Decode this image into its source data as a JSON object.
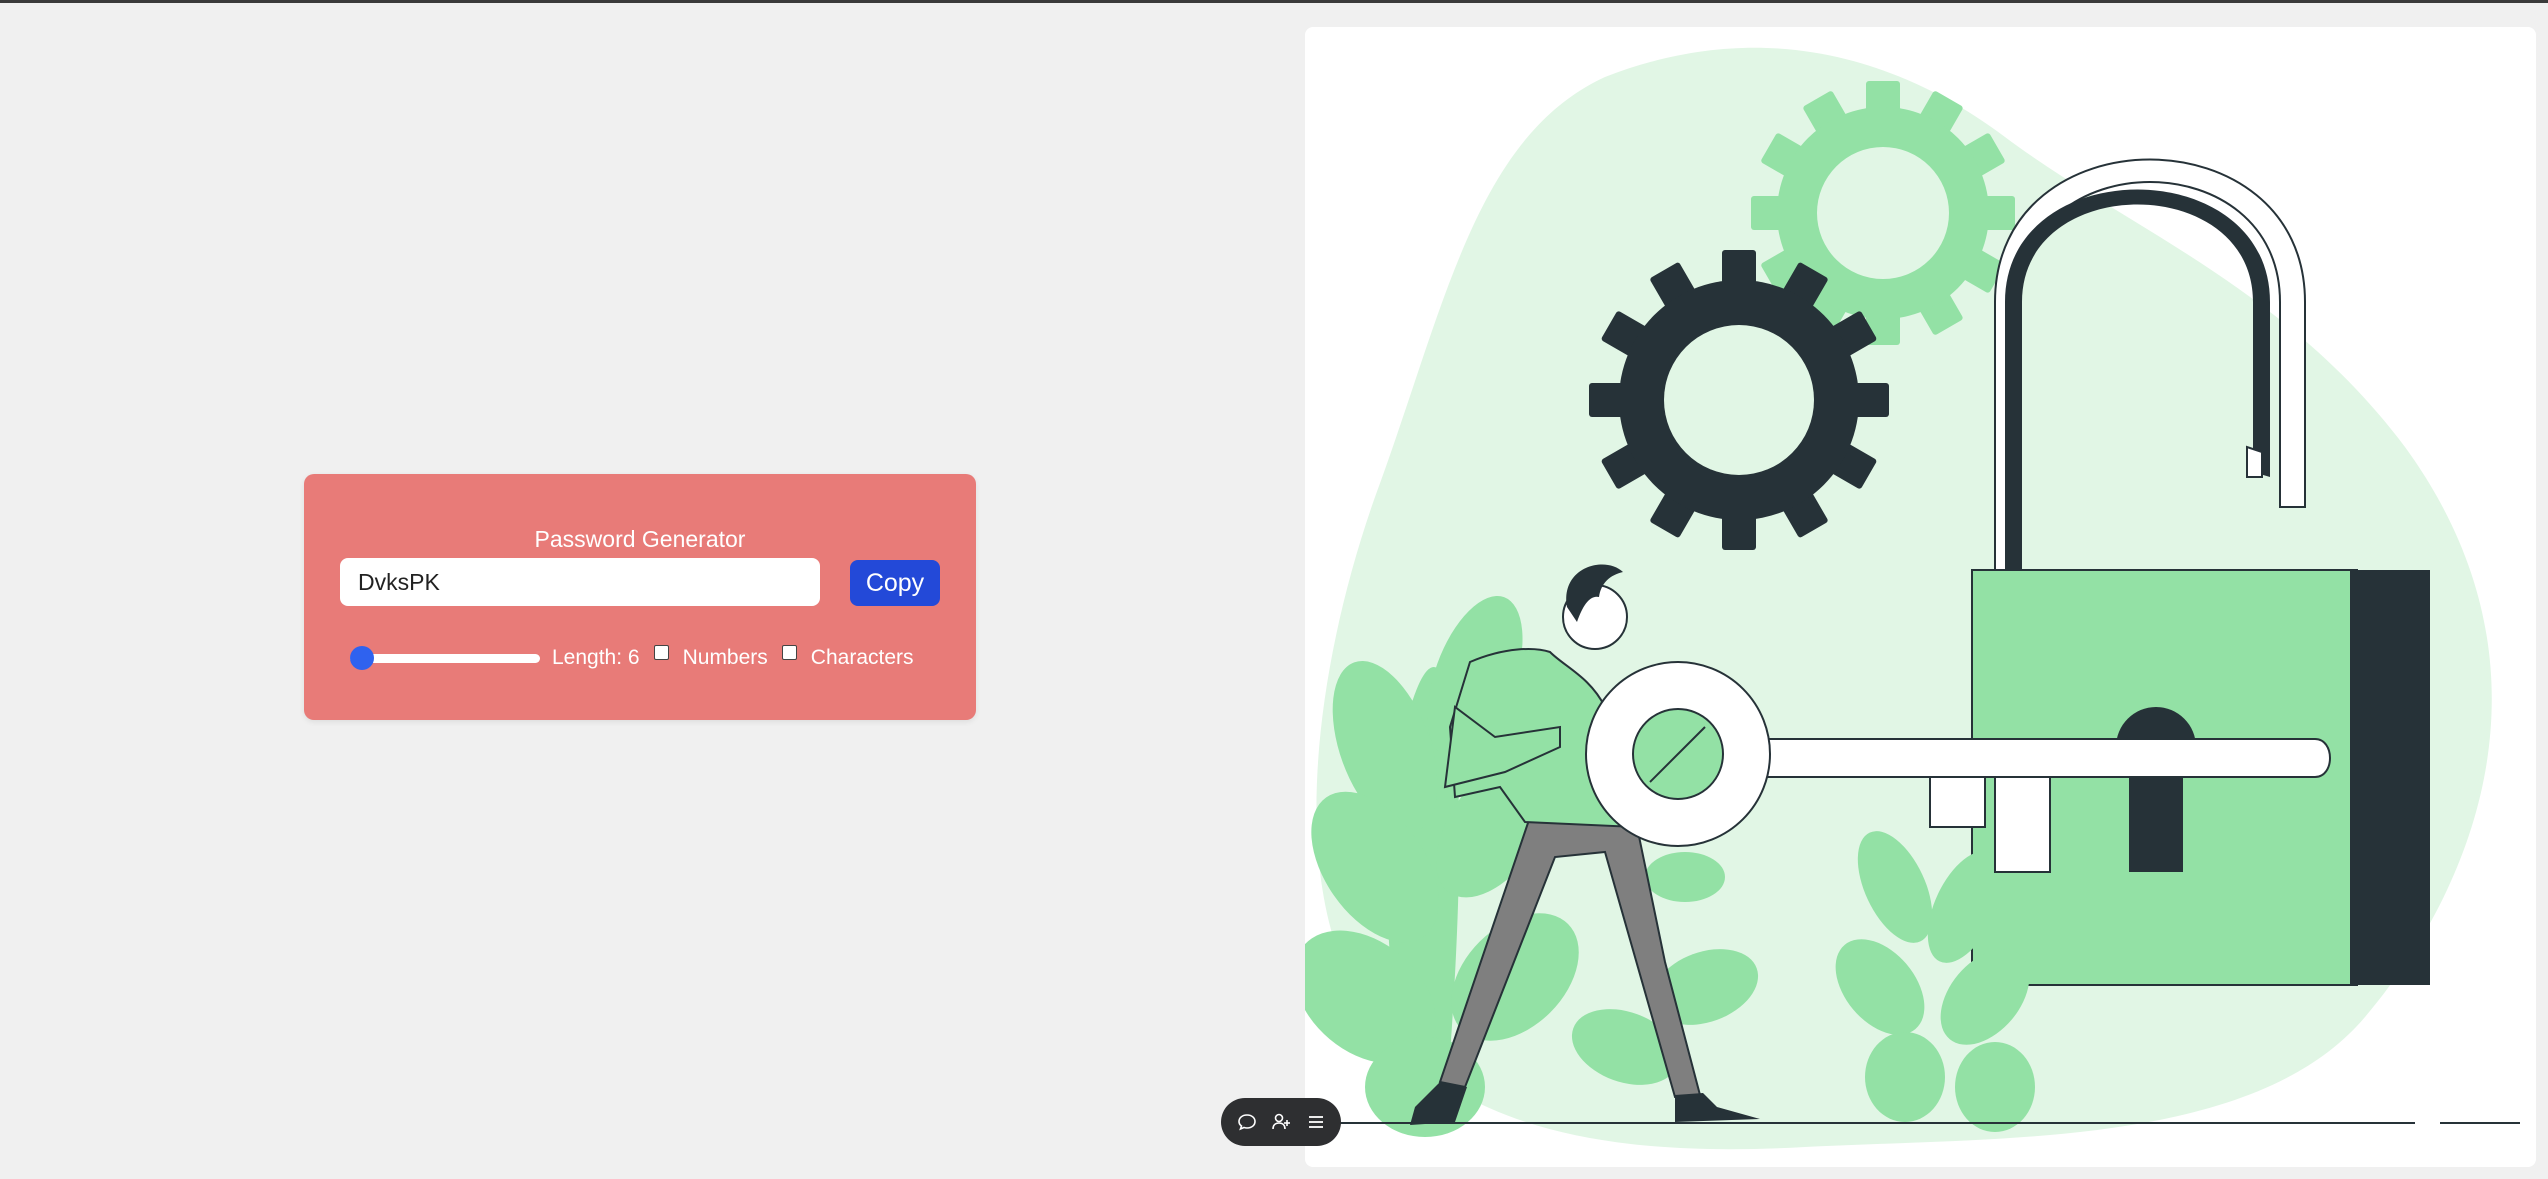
{
  "generator": {
    "title": "Password Generator",
    "password_value": "DvksPK",
    "copy_label": "Copy",
    "length_label": "Length: 6",
    "length_value": 6,
    "numbers_label": "Numbers",
    "numbers_checked": false,
    "characters_label": "Characters",
    "characters_checked": false
  },
  "illustration": {
    "icons": [
      "gear-icon",
      "padlock-icon",
      "key-icon",
      "person-figure",
      "plant-leaves"
    ]
  },
  "toolbar": {
    "icons": [
      "comment-icon",
      "add-person-icon",
      "menu-icon"
    ]
  },
  "colors": {
    "card_bg": "#e87b78",
    "copy_button": "#2349d8",
    "slider_thumb": "#2f62ef",
    "illus_green": "#93e1a5",
    "illus_light_green": "#e1f6e5",
    "illus_dark": "#263238"
  }
}
